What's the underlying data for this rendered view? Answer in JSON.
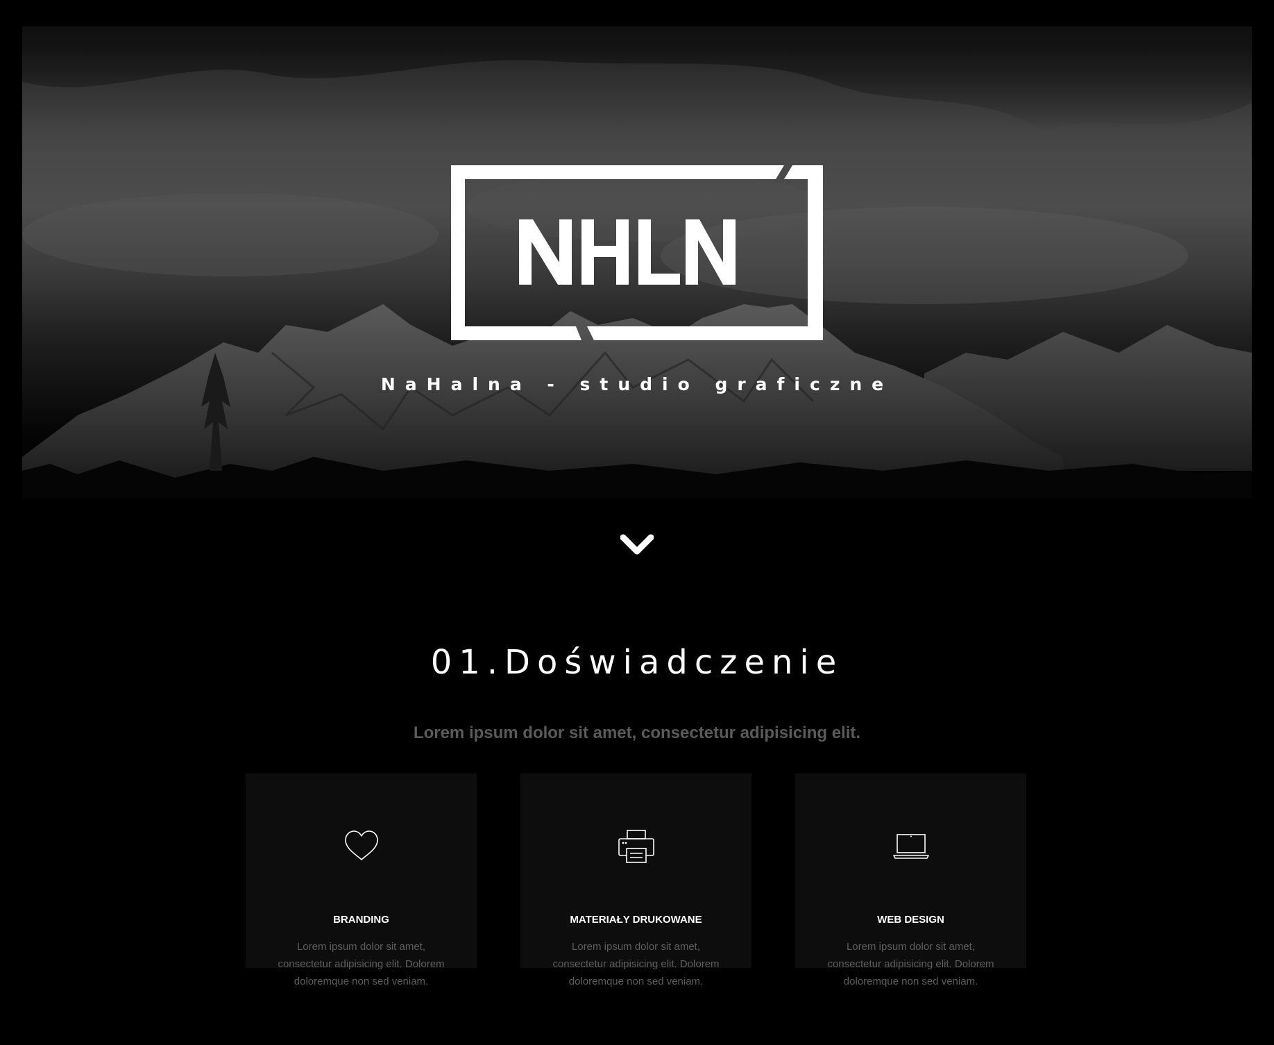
{
  "hero": {
    "logo_text": "NHLN",
    "tagline": "NaHalna - studio graficzne",
    "scroll_icon": "chevron-down-icon"
  },
  "section": {
    "title": "01.Doświadczenie",
    "subtitle": "Lorem ipsum dolor sit amet, consectetur adipisicing elit."
  },
  "cards": [
    {
      "icon": "heart-icon",
      "title": "BRANDING",
      "text": "Lorem ipsum dolor sit amet, consectetur adipisicing elit. Dolorem doloremque non sed veniam."
    },
    {
      "icon": "printer-icon",
      "title": "MATERIAŁY DRUKOWANE",
      "text": "Lorem ipsum dolor sit amet, consectetur adipisicing elit. Dolorem doloremque non sed veniam."
    },
    {
      "icon": "laptop-icon",
      "title": "WEB DESIGN",
      "text": "Lorem ipsum dolor sit amet, consectetur adipisicing elit. Dolorem doloremque non sed veniam."
    }
  ],
  "colors": {
    "background": "#000000",
    "card_bg": "#0d0d0d",
    "subtitle": "#5a5a5a",
    "text": "#ffffff"
  }
}
